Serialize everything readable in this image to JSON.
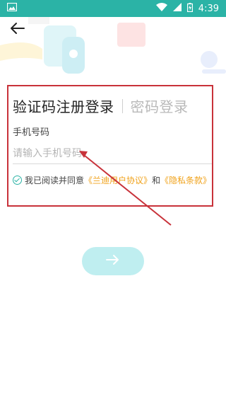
{
  "status_bar": {
    "time": "4:39",
    "icons": [
      "image-icon",
      "wifi-icon",
      "signal-icon",
      "battery-icon"
    ]
  },
  "header": {
    "back_icon": "back-arrow-icon"
  },
  "tabs": {
    "active": "验证码注册登录",
    "inactive": "密码登录"
  },
  "form": {
    "phone_label": "手机号码",
    "phone_placeholder": "请输入手机号码",
    "phone_value": ""
  },
  "agreement": {
    "prefix": "我已阅读并同意",
    "user_agreement": "《兰迪用户协议》",
    "conjunction": "和",
    "privacy_policy": "《隐私条款》",
    "checked": true
  },
  "next_button": {
    "icon": "arrow-right-icon"
  },
  "colors": {
    "status_bar": "#2bb3a6",
    "link": "#f0a21a",
    "next_button": "#bfeef0",
    "highlight": "#c8323a"
  }
}
